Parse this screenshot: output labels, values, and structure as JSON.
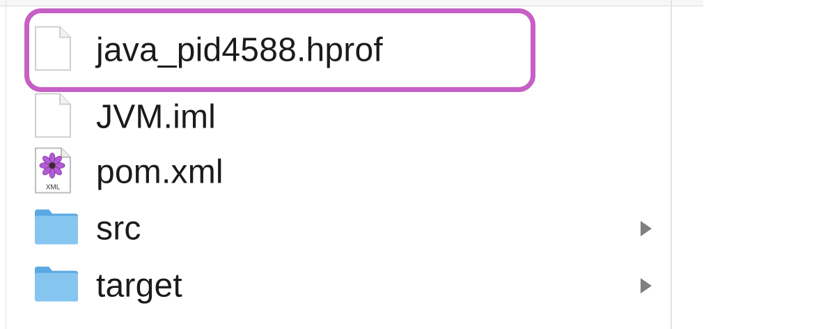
{
  "files": [
    {
      "name": "java_pid4588.hprof",
      "icon": "document-icon",
      "type": "file"
    },
    {
      "name": "JVM.iml",
      "icon": "document-icon",
      "type": "file"
    },
    {
      "name": "pom.xml",
      "icon": "xml-file-icon",
      "icon_badge": "XML",
      "type": "file"
    },
    {
      "name": "src",
      "icon": "folder-icon",
      "type": "folder"
    },
    {
      "name": "target",
      "icon": "folder-icon",
      "type": "folder"
    }
  ],
  "highlight_color": "#c65fc6",
  "folder_color": "#6cb4e8"
}
